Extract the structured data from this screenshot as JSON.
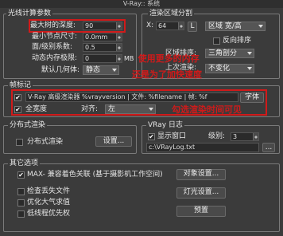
{
  "window": {
    "title": "V-Ray:: 系统"
  },
  "raycast": {
    "title": "光线计算参数",
    "max_depth_label": "最大树的深度:",
    "max_depth_value": "90",
    "min_leaf_label": "最小节点尺寸:",
    "min_leaf_value": "0.0mm",
    "face_coef_label": "面/级别系数:",
    "face_coef_value": "0.5",
    "mem_limit_label": "动态内存极限:",
    "mem_limit_value": "0",
    "mem_limit_unit": "MB",
    "default_geo_label": "默认几何体:",
    "default_geo_value": "静态"
  },
  "render_region": {
    "title": "渲染区域分割",
    "x_label": "X:",
    "x_value": "64",
    "l_label": "L",
    "region_wh_value": "区域 宽/高",
    "reverse_label": "反向排序",
    "sort_label": "区域排序:",
    "sort_value": "三角剖分",
    "prev_label": "上次渲染:",
    "prev_value": "不变化",
    "annotation": "使用更多的内存\n还是为了加快速度"
  },
  "stamp": {
    "title": "帧标记",
    "text": "V-Ray 高级渲染器 %vrayversion | 文件: %filename | 帧: %f",
    "font_button": "字体",
    "full_width_label": "全宽度",
    "align_label": "对齐:",
    "align_value": "左",
    "annotation": "勾选渲染时间可见"
  },
  "distributed": {
    "title": "分布式渲染",
    "checkbox_label": "分布式渲染",
    "settings_button": "设置..."
  },
  "vray_log": {
    "title": "VRay 日志",
    "show_window_label": "显示窗口",
    "level_label": "级别:",
    "level_value": "3",
    "path_value": "c:\\VRayLog.txt",
    "browse_button": "..."
  },
  "misc": {
    "title": "其它选项",
    "max_compat_label": "MAX- 兼容着色关联 (基于摄影机工作空间)",
    "check_missing_label": "检查丢失文件",
    "optimize_atmos_label": "优化大气求值",
    "low_priority_label": "低线程优先权",
    "objects_button": "对象设置...",
    "lights_button": "灯光设置...",
    "presets_button": "预置"
  }
}
